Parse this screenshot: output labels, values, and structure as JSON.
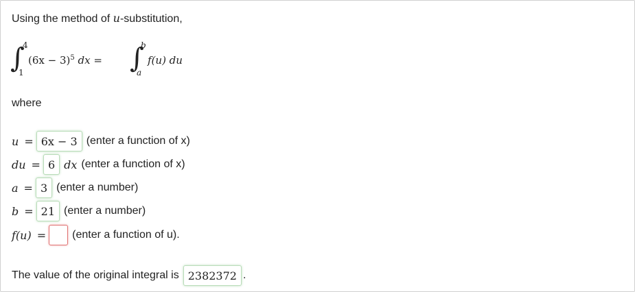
{
  "intro": {
    "text_before": "Using the method of ",
    "var": "u",
    "text_after": "-substitution,"
  },
  "integral": {
    "lower": "1",
    "upper": "4",
    "integrand": "(6x − 3)",
    "power": "5",
    "differential": "dx",
    "equals": "=",
    "rhs_lower": "a",
    "rhs_upper": "b",
    "rhs_integrand": "f(u) du"
  },
  "where_label": "where",
  "rows": [
    {
      "label": "u",
      "equals": "=",
      "value": "6x − 3",
      "suffix": "",
      "hint": "(enter a function of x)"
    },
    {
      "label": "du",
      "equals": "=",
      "value": "6",
      "suffix": "dx",
      "hint": "(enter a function of x)"
    },
    {
      "label": "a",
      "equals": "=",
      "value": "3",
      "suffix": "",
      "hint": "(enter a number)"
    },
    {
      "label": "b",
      "equals": "=",
      "value": "21",
      "suffix": "",
      "hint": "(enter a number)"
    },
    {
      "label": "f(u)",
      "equals": "=",
      "value": "",
      "suffix": "",
      "hint": "(enter a function of u)."
    }
  ],
  "final": {
    "text": "The value of the original integral is",
    "value": "2382372",
    "end": "."
  }
}
